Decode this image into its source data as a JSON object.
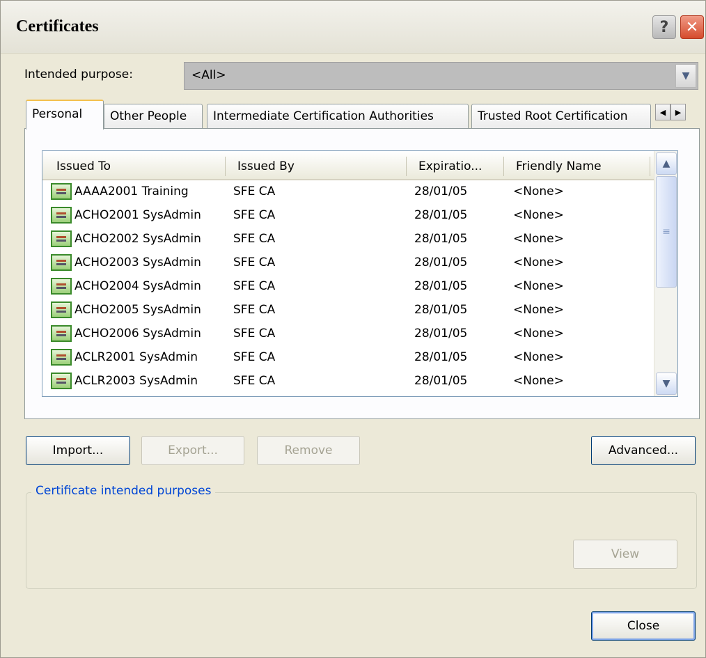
{
  "window": {
    "title": "Certificates"
  },
  "purpose": {
    "label": "Intended purpose:",
    "value": "<All>"
  },
  "tabs": [
    {
      "label": "Personal"
    },
    {
      "label": "Other People"
    },
    {
      "label": "Intermediate Certification Authorities"
    },
    {
      "label": "Trusted Root Certification"
    }
  ],
  "columns": [
    "Issued To",
    "Issued By",
    "Expiratio...",
    "Friendly Name"
  ],
  "rows": [
    [
      "AAAA2001 Training",
      "SFE CA",
      "28/01/05",
      "<None>"
    ],
    [
      "ACHO2001 SysAdmin",
      "SFE CA",
      "28/01/05",
      "<None>"
    ],
    [
      "ACHO2002 SysAdmin",
      "SFE CA",
      "28/01/05",
      "<None>"
    ],
    [
      "ACHO2003 SysAdmin",
      "SFE CA",
      "28/01/05",
      "<None>"
    ],
    [
      "ACHO2004 SysAdmin",
      "SFE CA",
      "28/01/05",
      "<None>"
    ],
    [
      "ACHO2005 SysAdmin",
      "SFE CA",
      "28/01/05",
      "<None>"
    ],
    [
      "ACHO2006 SysAdmin",
      "SFE CA",
      "28/01/05",
      "<None>"
    ],
    [
      "ACLR2001 SysAdmin",
      "SFE CA",
      "28/01/05",
      "<None>"
    ],
    [
      "ACLR2003 SysAdmin",
      "SFE CA",
      "28/01/05",
      "<None>"
    ]
  ],
  "buttons": {
    "import": "Import...",
    "export": "Export...",
    "remove": "Remove",
    "advanced": "Advanced...",
    "view": "View",
    "close": "Close"
  },
  "group": {
    "title": "Certificate intended purposes"
  },
  "icons": {
    "help": "help-icon",
    "close": "close-icon",
    "certificate": "certificate-icon"
  }
}
